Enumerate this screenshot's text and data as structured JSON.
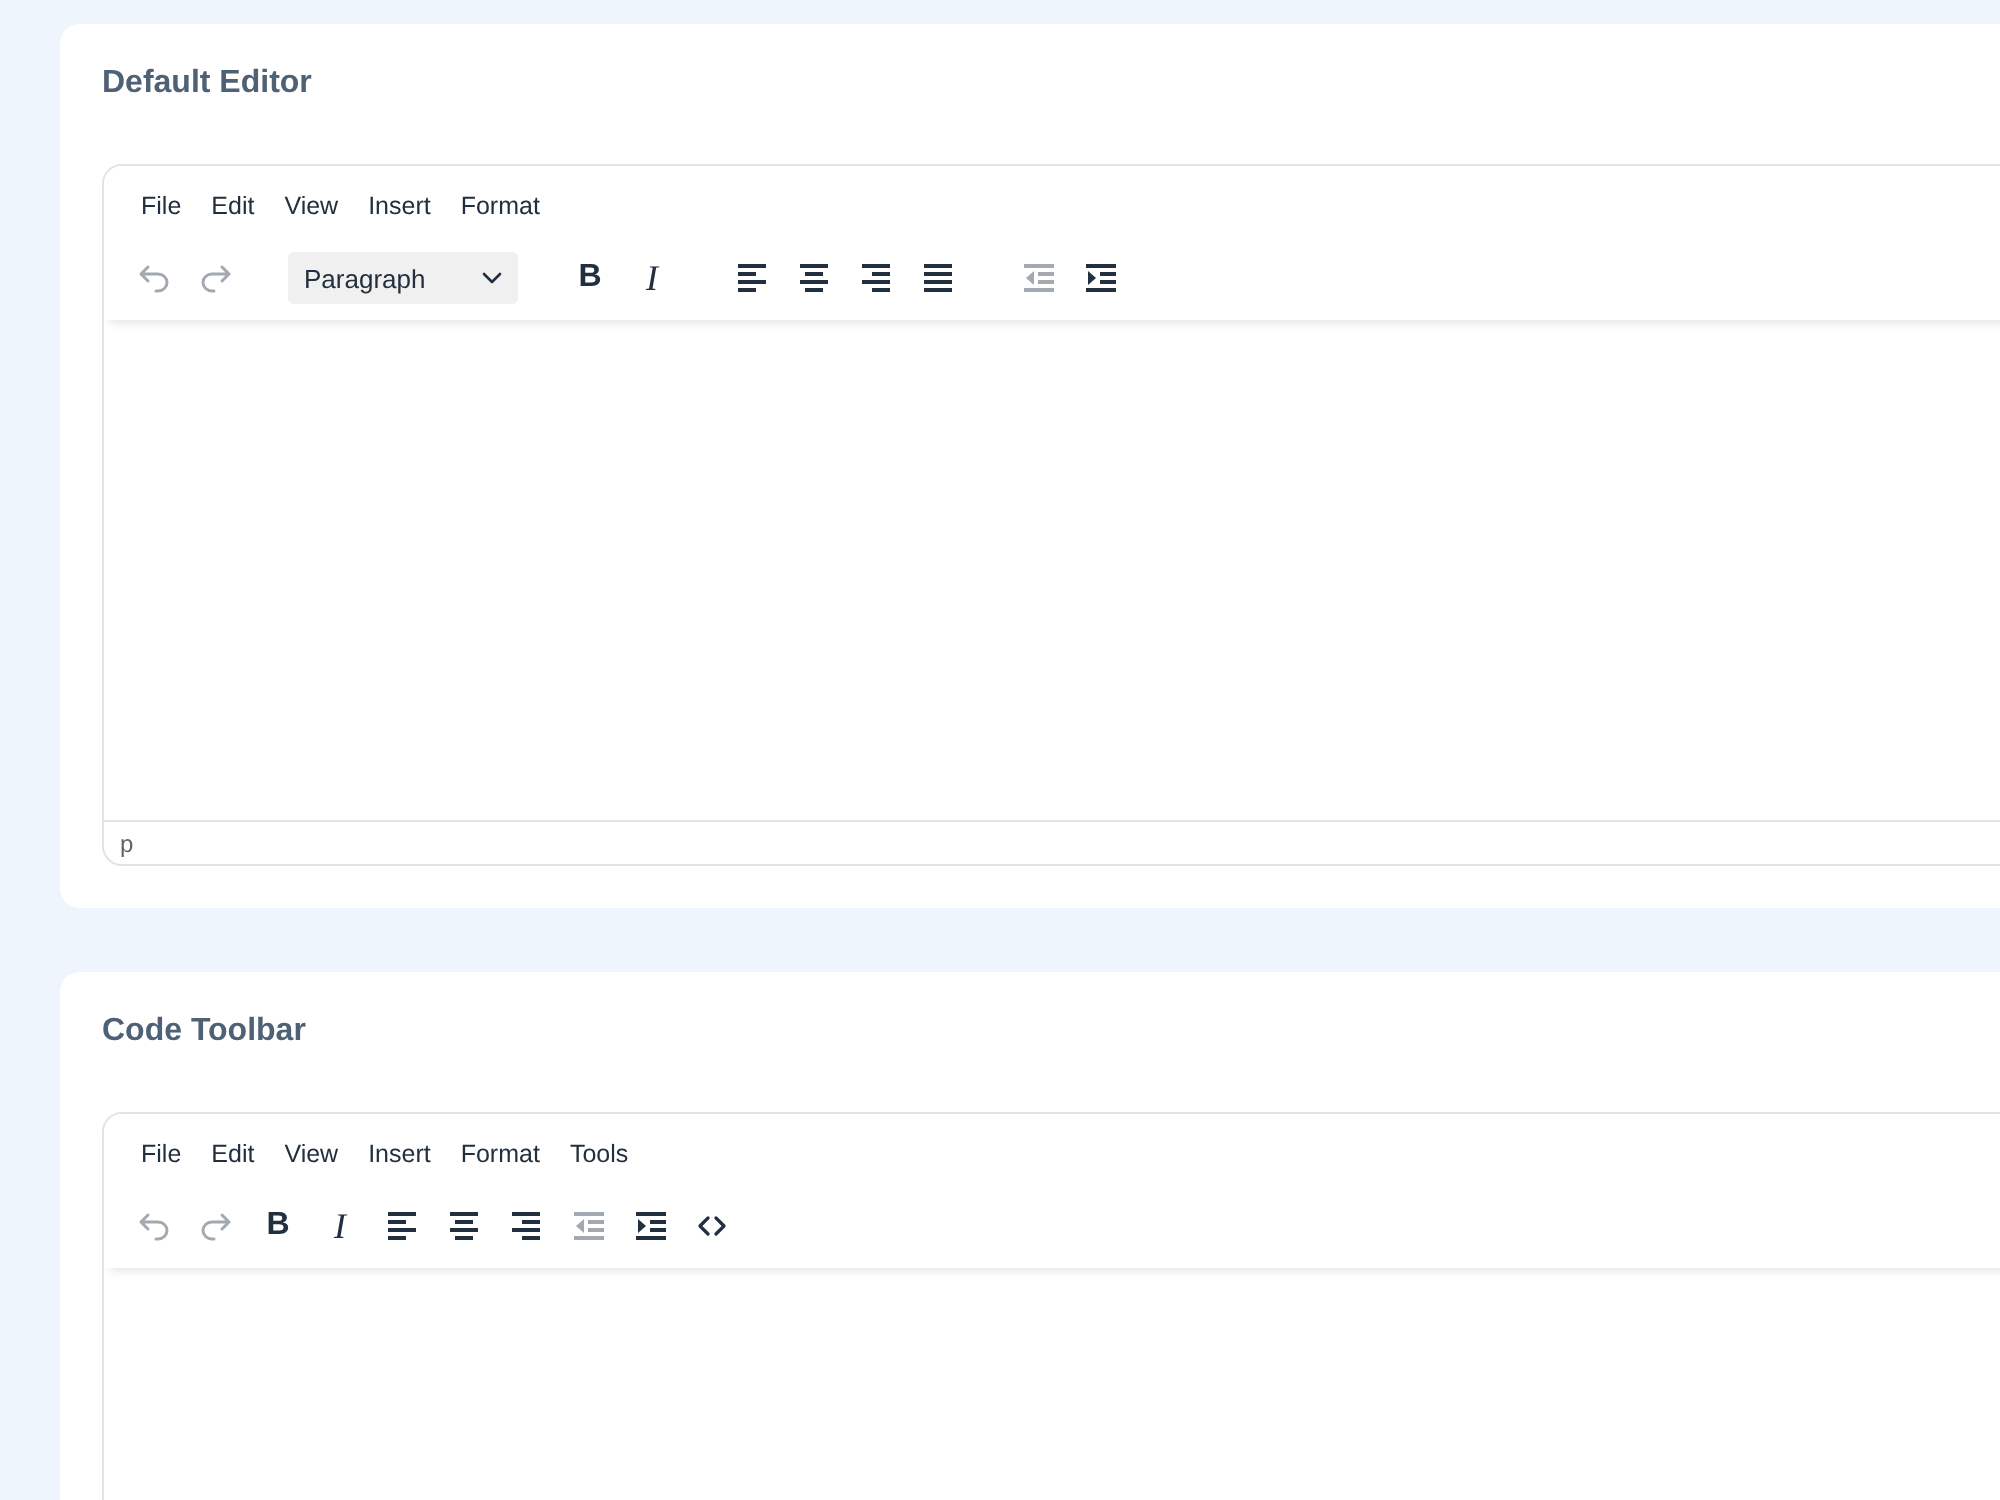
{
  "editors": [
    {
      "title": "Default Editor",
      "menu": [
        "File",
        "Edit",
        "View",
        "Insert",
        "Format"
      ],
      "toolbar": [
        [
          {
            "kind": "undo",
            "disabled": true
          },
          {
            "kind": "redo",
            "disabled": true
          }
        ],
        [
          {
            "kind": "select",
            "value": "Paragraph",
            "disabled": false
          }
        ],
        [
          {
            "kind": "bold",
            "label": "B",
            "disabled": false
          },
          {
            "kind": "italic",
            "label": "I",
            "disabled": false
          }
        ],
        [
          {
            "kind": "align-left",
            "disabled": false
          },
          {
            "kind": "align-center",
            "disabled": false
          },
          {
            "kind": "align-right",
            "disabled": false
          },
          {
            "kind": "justify",
            "disabled": false
          }
        ],
        [
          {
            "kind": "outdent",
            "disabled": true
          },
          {
            "kind": "indent",
            "disabled": false
          }
        ]
      ],
      "status_path": "p"
    },
    {
      "title": "Code Toolbar",
      "menu": [
        "File",
        "Edit",
        "View",
        "Insert",
        "Format",
        "Tools"
      ],
      "toolbar": [
        [
          {
            "kind": "undo",
            "disabled": true
          },
          {
            "kind": "redo",
            "disabled": true
          },
          {
            "kind": "bold",
            "label": "B",
            "disabled": false
          },
          {
            "kind": "italic",
            "label": "I",
            "disabled": false
          },
          {
            "kind": "align-left",
            "disabled": false
          },
          {
            "kind": "align-center",
            "disabled": false
          },
          {
            "kind": "align-right",
            "disabled": false
          },
          {
            "kind": "outdent",
            "disabled": true
          },
          {
            "kind": "indent",
            "disabled": false
          },
          {
            "kind": "code",
            "disabled": false
          }
        ]
      ]
    }
  ]
}
